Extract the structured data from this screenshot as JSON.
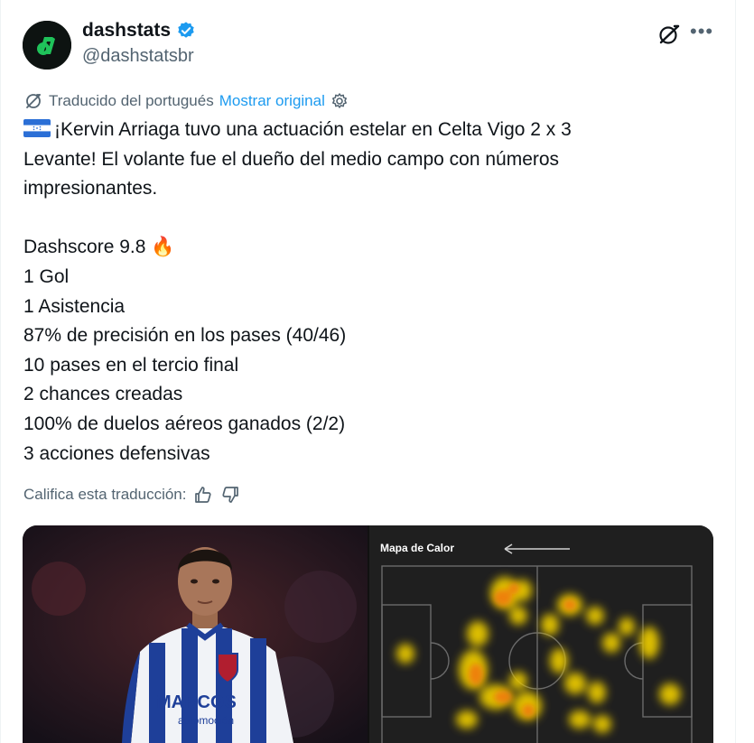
{
  "author": {
    "name": "dashstats",
    "handle": "@dashstatsbr",
    "avatar_letter": "d",
    "verified": true
  },
  "translation": {
    "note": "Traducido del portugués",
    "show_original": "Mostrar original"
  },
  "tweet": {
    "lines": [
      "¡Kervin Arriaga tuvo una actuación estelar en Celta Vigo 2 x 3",
      "Levante! El volante fue el dueño del medio campo con números",
      "impresionantes.",
      "",
      "Dashscore 9.8 🔥",
      "1 Gol",
      "1 Asistencia",
      "87% de precisión en los pases (40/46)",
      "10 pases en el tercio final",
      "2 chances creadas",
      "100% de duelos aéreos ganados (2/2)",
      "3 acciones defensivas"
    ]
  },
  "rate_translation": "Califica esta traducción:",
  "media": {
    "heatmap_title": "Mapa de Calor",
    "jersey_text": "MARCOS",
    "jersey_subtext": "automoción"
  },
  "colors": {
    "accent": "#1d9bf0",
    "muted": "#536471",
    "brand_green": "#1fc35a"
  }
}
